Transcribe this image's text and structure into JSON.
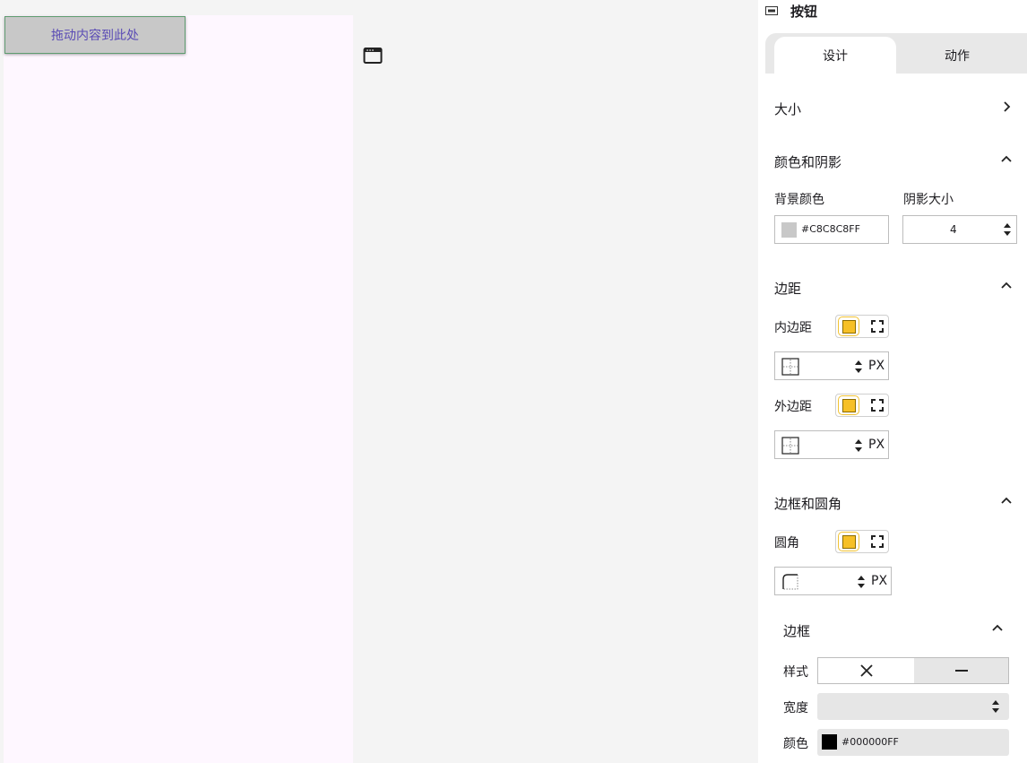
{
  "canvas": {
    "drop_label": "拖动内容到此处"
  },
  "panel": {
    "title": "按钮",
    "tabs": [
      {
        "label": "设计",
        "active": true
      },
      {
        "label": "动作",
        "active": false
      }
    ],
    "size": {
      "title": "大小"
    },
    "color_shadow": {
      "title": "颜色和阴影",
      "bg_label": "背景颜色",
      "bg_value": "#C8C8C8FF",
      "bg_swatch": "#C8C8C8",
      "shadow_label": "阴影大小",
      "shadow_value": "4"
    },
    "spacing": {
      "title": "边距",
      "padding_label": "内边距",
      "margin_label": "外边距",
      "unit": "PX"
    },
    "border_radius": {
      "title": "边框和圆角",
      "radius_label": "圆角",
      "unit": "PX"
    },
    "border": {
      "title": "边框",
      "style_label": "样式",
      "width_label": "宽度",
      "color_label": "颜色",
      "color_value": "#000000FF",
      "color_swatch": "#000000"
    }
  },
  "colors": {
    "accent": "#F6C026",
    "canvas_bg": "#FEF7FF",
    "button_bg": "#C8C8C8"
  }
}
